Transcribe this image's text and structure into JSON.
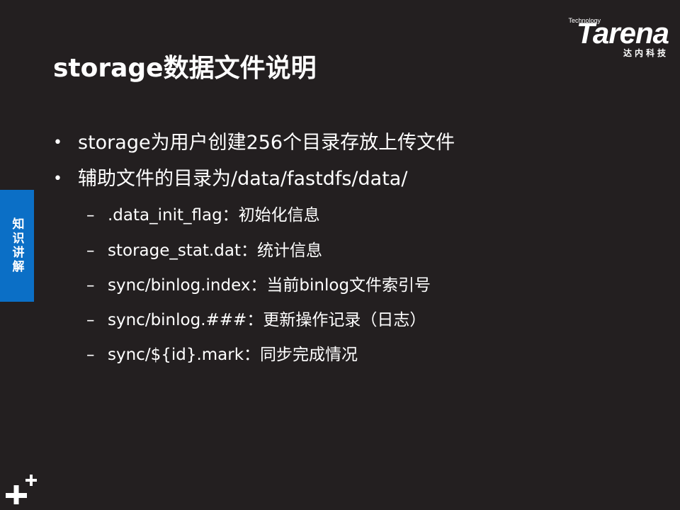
{
  "logo": {
    "small_text": "Technology",
    "main_text": "Tarena",
    "sub_text": "达内科技"
  },
  "slide": {
    "title": "storage数据文件说明",
    "side_tab": "知识讲解",
    "bullet_marker": "•",
    "sub_marker": "–",
    "bullets": [
      {
        "text": "storage为用户创建256个目录存放上传文件"
      },
      {
        "text": "辅助文件的目录为/data/fastdfs/data/"
      }
    ],
    "sub_items": [
      {
        "text": ".data_init_flag：初始化信息"
      },
      {
        "text": "storage_stat.dat：统计信息"
      },
      {
        "text": "sync/binlog.index：当前binlog文件索引号"
      },
      {
        "text": "sync/binlog.###：更新操作记录（日志）"
      },
      {
        "text": "sync/${id}.mark：同步完成情况"
      }
    ]
  }
}
